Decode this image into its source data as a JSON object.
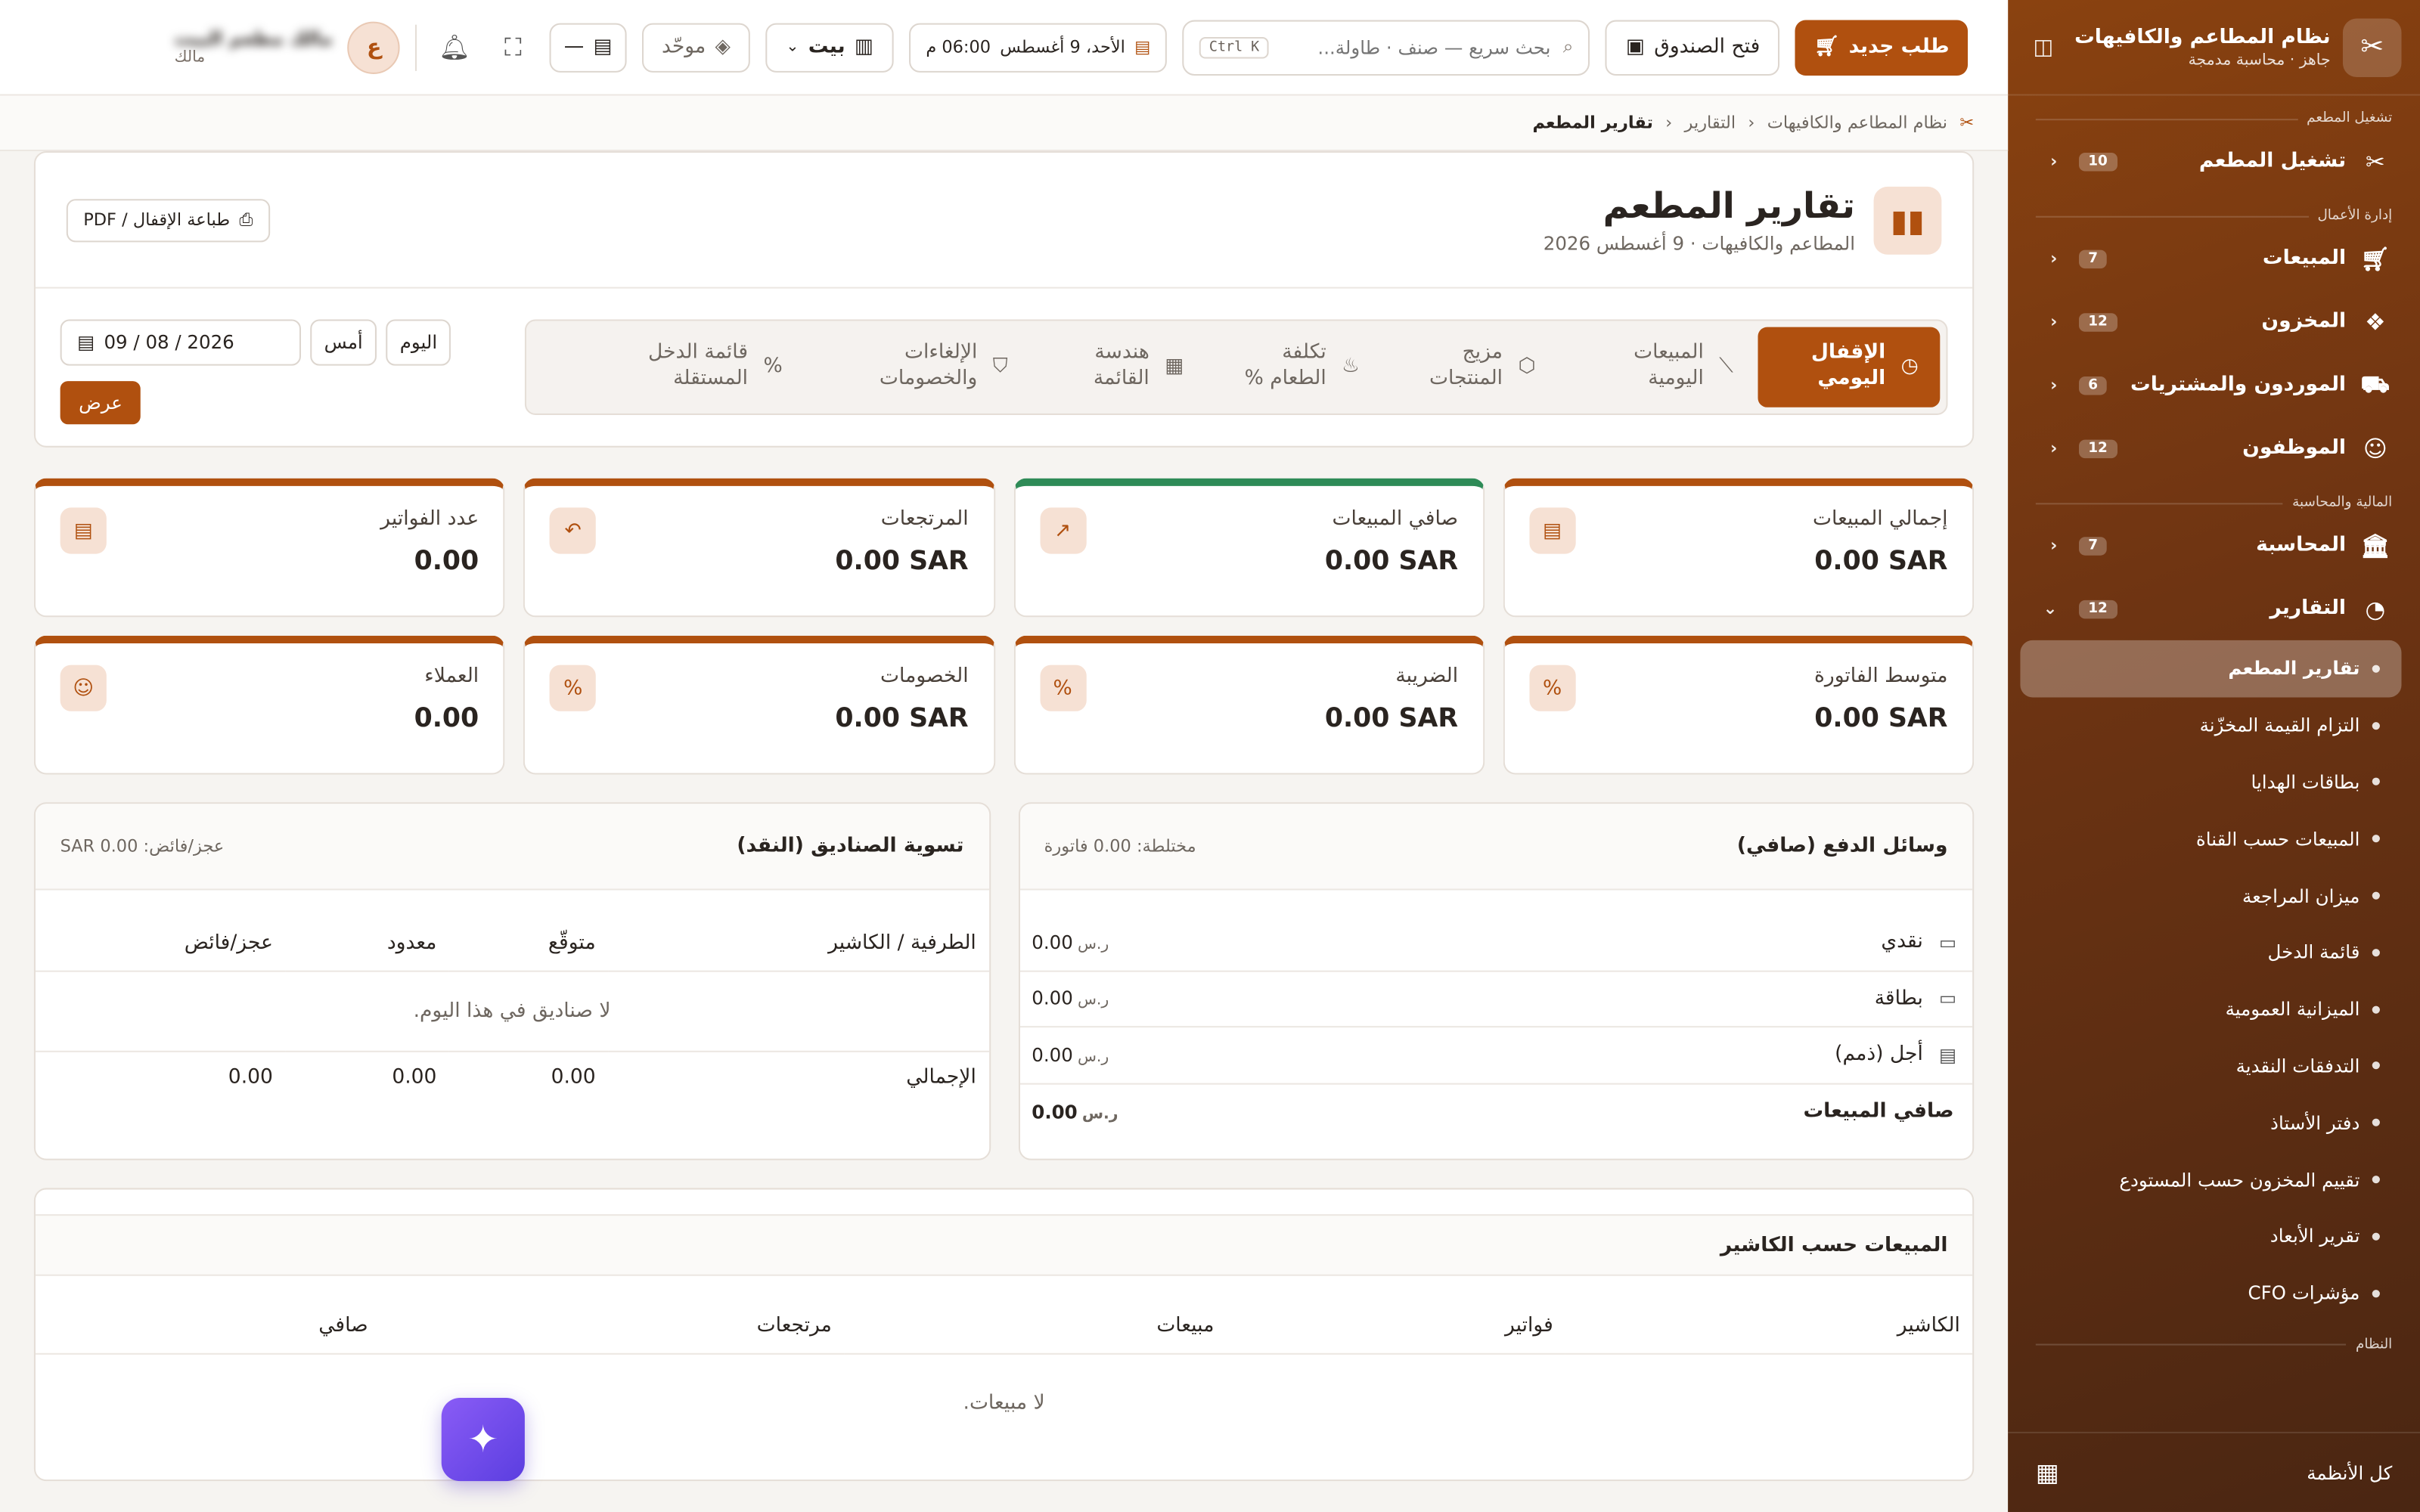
{
  "sidebar": {
    "app_title": "نظام المطاعم والكافيهات",
    "app_subtitle": "جاهز · محاسبة مدمجة",
    "sections": {
      "ops": "تشغيل المطعم",
      "biz": "إدارة الأعمال",
      "fin": "المالية والمحاسبة",
      "sys": "النظام"
    },
    "items": [
      {
        "label": "تشغيل المطعم",
        "badge": "10"
      },
      {
        "label": "المبيعات",
        "badge": "7"
      },
      {
        "label": "المخزون",
        "badge": "12"
      },
      {
        "label": "الموردون والمشتريات",
        "badge": "6"
      },
      {
        "label": "الموظفون",
        "badge": "12"
      },
      {
        "label": "المحاسبة",
        "badge": "7"
      },
      {
        "label": "التقارير",
        "badge": "12"
      }
    ],
    "report_items": [
      "تقارير المطعم",
      "التزام القيمة المخزّنة",
      "بطاقات الهدايا",
      "المبيعات حسب القناة",
      "ميزان المراجعة",
      "قائمة الدخل",
      "الميزانية العمومية",
      "التدفقات النقدية",
      "دفتر الأستاذ",
      "تقييم المخزون حسب المستودع",
      "تقرير الأبعاد",
      "مؤشرات CFO"
    ],
    "footer_label": "كل الأنظمة"
  },
  "topbar": {
    "new_order": "طلب جديد",
    "open_drawer": "فتح الصندوق",
    "search_placeholder": "بحث سريع — صنف · طاولة...",
    "search_kbd": "Ctrl K",
    "datetime": "الأحد، 9 أغسطس",
    "time": "06:00 م",
    "branch": "بيت",
    "unified": "موحّد",
    "dash": "—",
    "avatar_letter": "ع",
    "user_name": "مالك مطعم البيت",
    "user_role": "مالك"
  },
  "breadcrumb": [
    "نظام المطاعم والكافيهات",
    "التقارير",
    "تقارير المطعم"
  ],
  "header": {
    "title": "تقارير المطعم",
    "subtitle": "المطاعم والكافيهات · 9 أغسطس 2026",
    "print": "طباعة الإقفال / PDF"
  },
  "tabs": [
    "الإقفال اليومي",
    "المبيعات اليومية",
    "مزيج المنتجات",
    "تكلفة الطعام %",
    "هندسة القائمة",
    "الإلغاءات والخصومات",
    "قائمة الدخل المستقلة"
  ],
  "date_controls": {
    "today": "اليوم",
    "yesterday": "أمس",
    "date": "09 / 08 / 2026",
    "show": "عرض"
  },
  "stats": [
    {
      "label": "إجمالي المبيعات",
      "value": "0.00 SAR"
    },
    {
      "label": "صافي المبيعات",
      "value": "0.00 SAR"
    },
    {
      "label": "المرتجعات",
      "value": "0.00 SAR"
    },
    {
      "label": "عدد الفواتير",
      "value": "0.00"
    },
    {
      "label": "متوسط الفاتورة",
      "value": "0.00 SAR"
    },
    {
      "label": "الضريبة",
      "value": "0.00 SAR"
    },
    {
      "label": "الخصومات",
      "value": "0.00 SAR"
    },
    {
      "label": "العملاء",
      "value": "0.00"
    }
  ],
  "payments": {
    "title": "وسائل الدفع (صافي)",
    "meta": "مختلطة: 0.00 فاتورة",
    "currency": "ر.س",
    "rows": [
      {
        "label": "نقدي",
        "value": "0.00"
      },
      {
        "label": "بطاقة",
        "value": "0.00"
      },
      {
        "label": "أجل (ذمم)",
        "value": "0.00"
      }
    ],
    "total_label": "صافي المبيعات",
    "total_value": "0.00"
  },
  "cash": {
    "title": "تسوية الصناديق (النقد)",
    "meta": "عجز/فائض: 0.00 SAR",
    "cols": [
      "الطرفية / الكاشير",
      "متوقّع",
      "معدود",
      "عجز/فائض"
    ],
    "empty": "لا صناديق في هذا اليوم.",
    "total_label": "الإجمالي",
    "totals": [
      "0.00",
      "0.00",
      "0.00"
    ]
  },
  "by_cashier": {
    "title": "المبيعات حسب الكاشير",
    "cols": [
      "الكاشير",
      "فواتير",
      "مبيعات",
      "مرتجعات",
      "صافي"
    ],
    "empty": "لا مبيعات."
  },
  "colors": {
    "accent": "#b0500f",
    "green": "#2e8b57"
  }
}
